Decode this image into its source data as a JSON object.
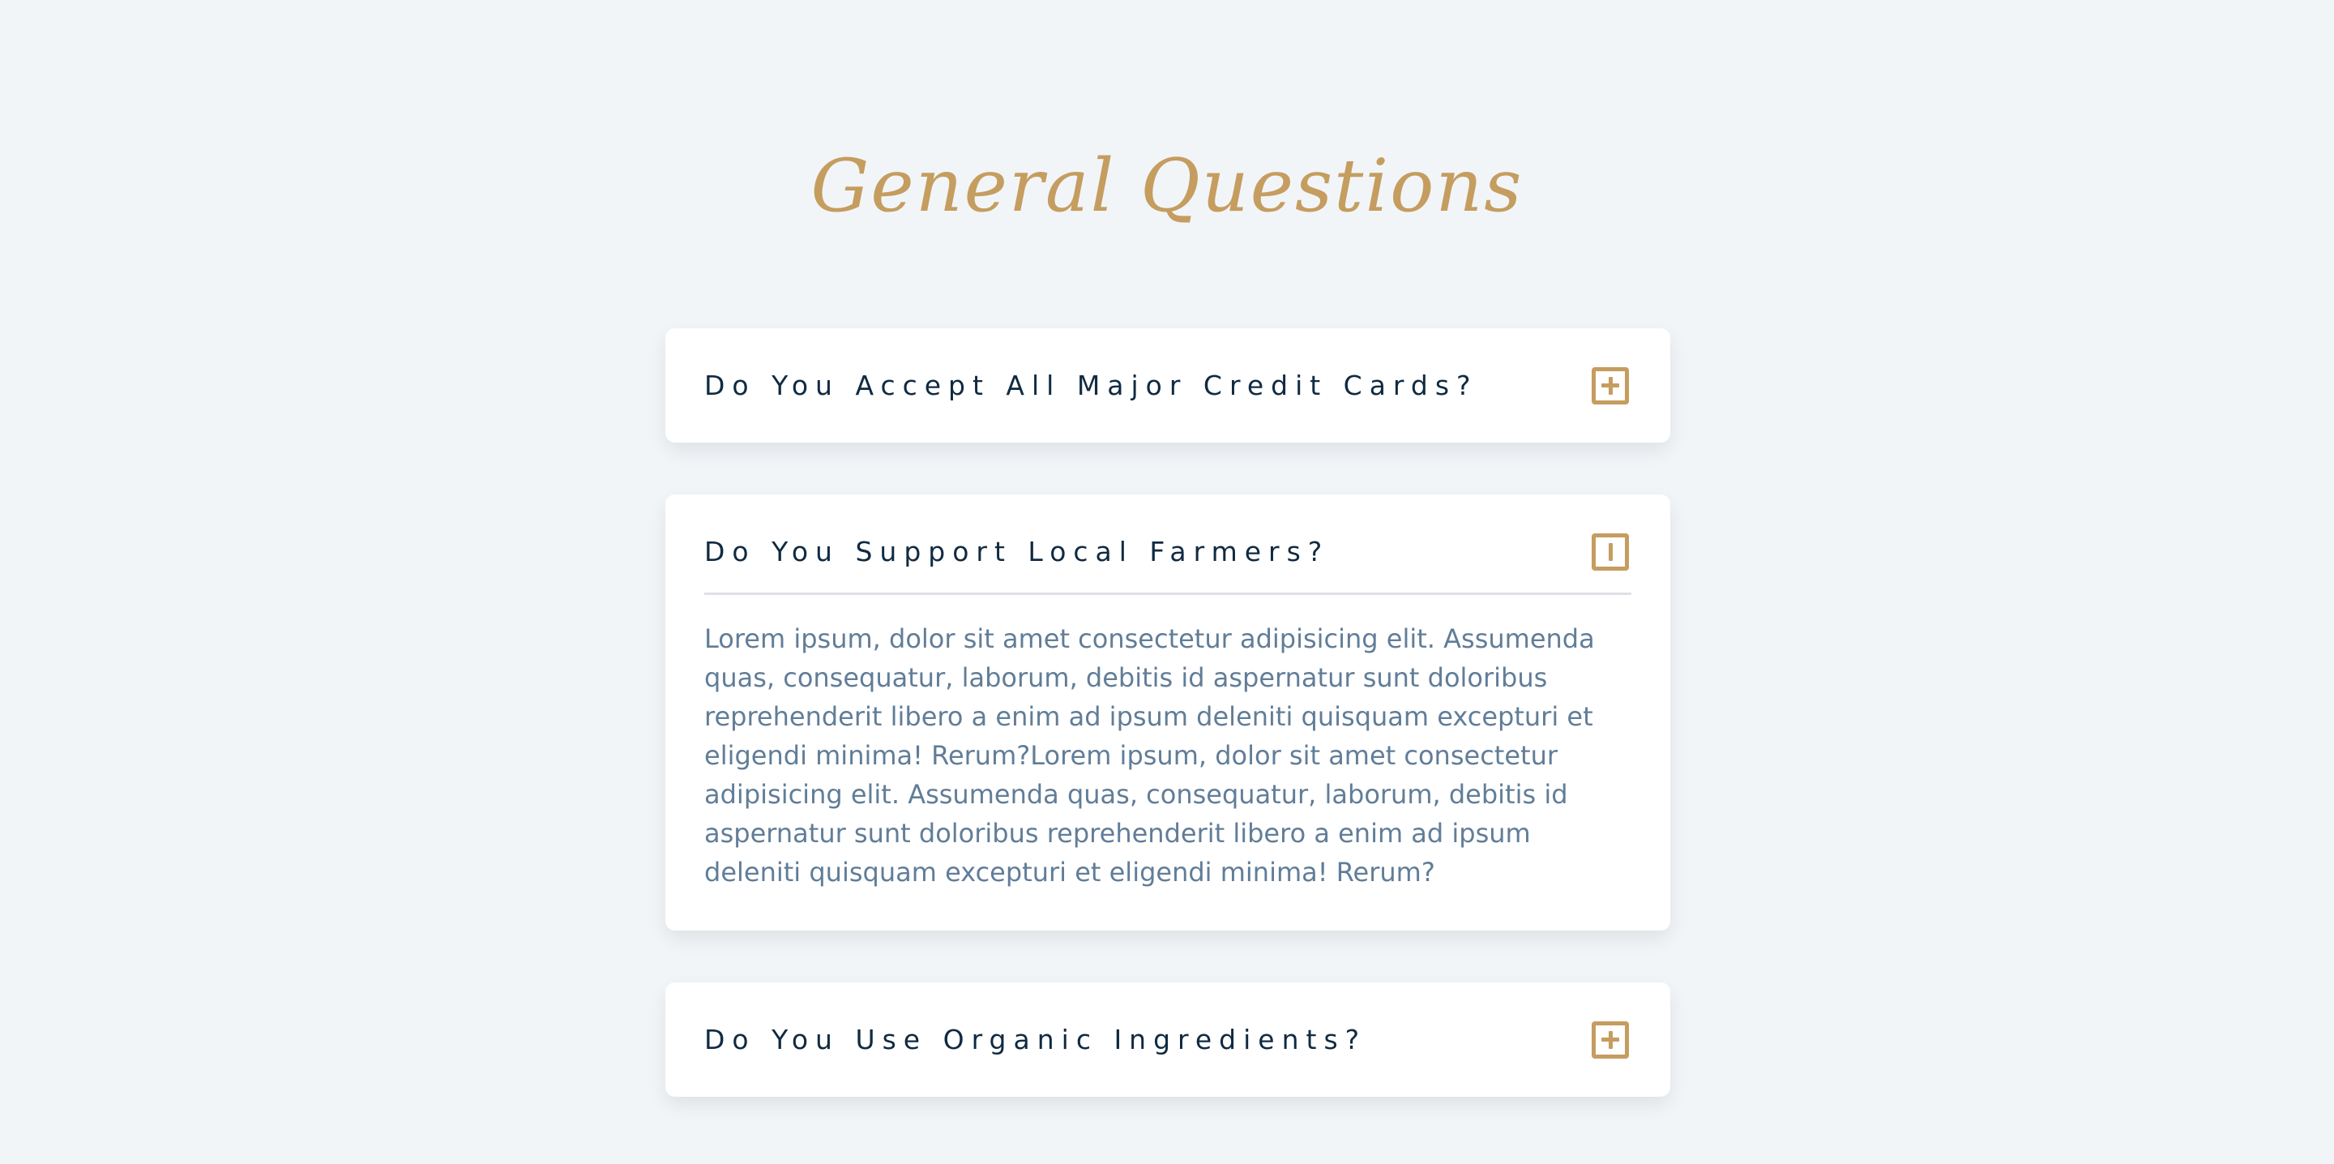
{
  "page": {
    "title": "General Questions"
  },
  "questions": [
    {
      "title": "Do You Accept All Major Credit Cards?",
      "icon": "plus-square-icon",
      "expanded": false
    },
    {
      "title": "Do You Support Local Farmers?",
      "icon": "minus-square-icon",
      "expanded": true,
      "answer": "Lorem ipsum, dolor sit amet consectetur adipisicing elit. Assumenda quas, consequatur, laborum, debitis id aspernatur sunt doloribus reprehenderit libero a enim ad ipsum deleniti quisquam excepturi et eligendi minima! Rerum?Lorem ipsum, dolor sit amet consectetur adipisicing elit. Assumenda quas, consequatur, laborum, debitis id aspernatur sunt doloribus reprehenderit libero a enim ad ipsum deleniti quisquam excepturi et eligendi minima! Rerum?"
    },
    {
      "title": "Do You Use Organic Ingredients?",
      "icon": "plus-square-icon",
      "expanded": false
    }
  ],
  "colors": {
    "background": "#f1f5f8",
    "accent": "#c59d5f",
    "question_text": "#102a42",
    "answer_text": "#617d98",
    "card": "#ffffff"
  }
}
